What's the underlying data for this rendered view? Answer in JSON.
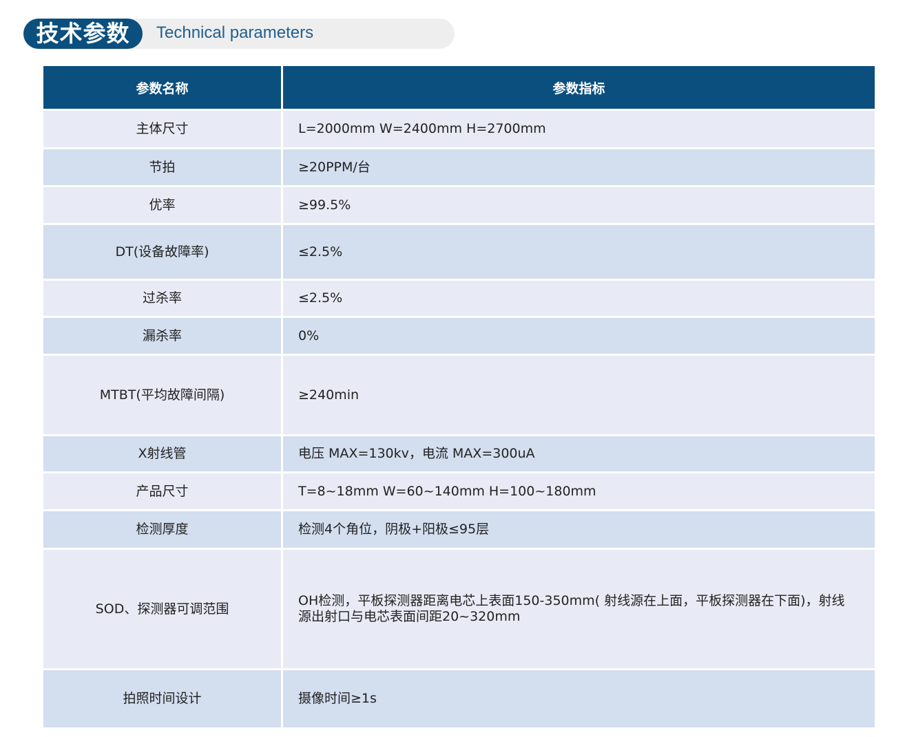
{
  "header": {
    "title_zh": "技术参数",
    "title_en": "Technical parameters"
  },
  "table": {
    "columns": [
      "参数名称",
      "参数指标"
    ],
    "rows": [
      {
        "name": "主体尺寸",
        "value": "L=2000mm  W=2400mm  H=2700mm"
      },
      {
        "name": "节拍",
        "value": "≥20PPM/台"
      },
      {
        "name": "优率",
        "value": "≥99.5%"
      },
      {
        "name": "DT(设备故障率)",
        "value": "≤2.5%"
      },
      {
        "name": "过杀率",
        "value": "≤2.5%"
      },
      {
        "name": "漏杀率",
        "value": "0%"
      },
      {
        "name": "MTBT(平均故障间隔)",
        "value": "≥240min"
      },
      {
        "name": "X射线管",
        "value": "电压 MAX=130kv，电流 MAX=300uA"
      },
      {
        "name": "产品尺寸",
        "value": "T=8~18mm  W=60~140mm  H=100~180mm"
      },
      {
        "name": "检测厚度",
        "value": "检测4个角位，阴极+阳极≤95层"
      },
      {
        "name": "SOD、探测器可调范围",
        "value": "OH检测，平板探测器距离电芯上表面150-350mm( 射线源在上面，平板探测器在下面)，射线源出射口与电芯表面间距20~320mm"
      },
      {
        "name": "拍照时间设计",
        "value": "摄像时间≥1s"
      }
    ]
  },
  "colors": {
    "header_blue": "#0b4f7e",
    "row_light": "#e8ebf5",
    "row_dark": "#d3deef",
    "banner_gray": "#eeeeee"
  }
}
